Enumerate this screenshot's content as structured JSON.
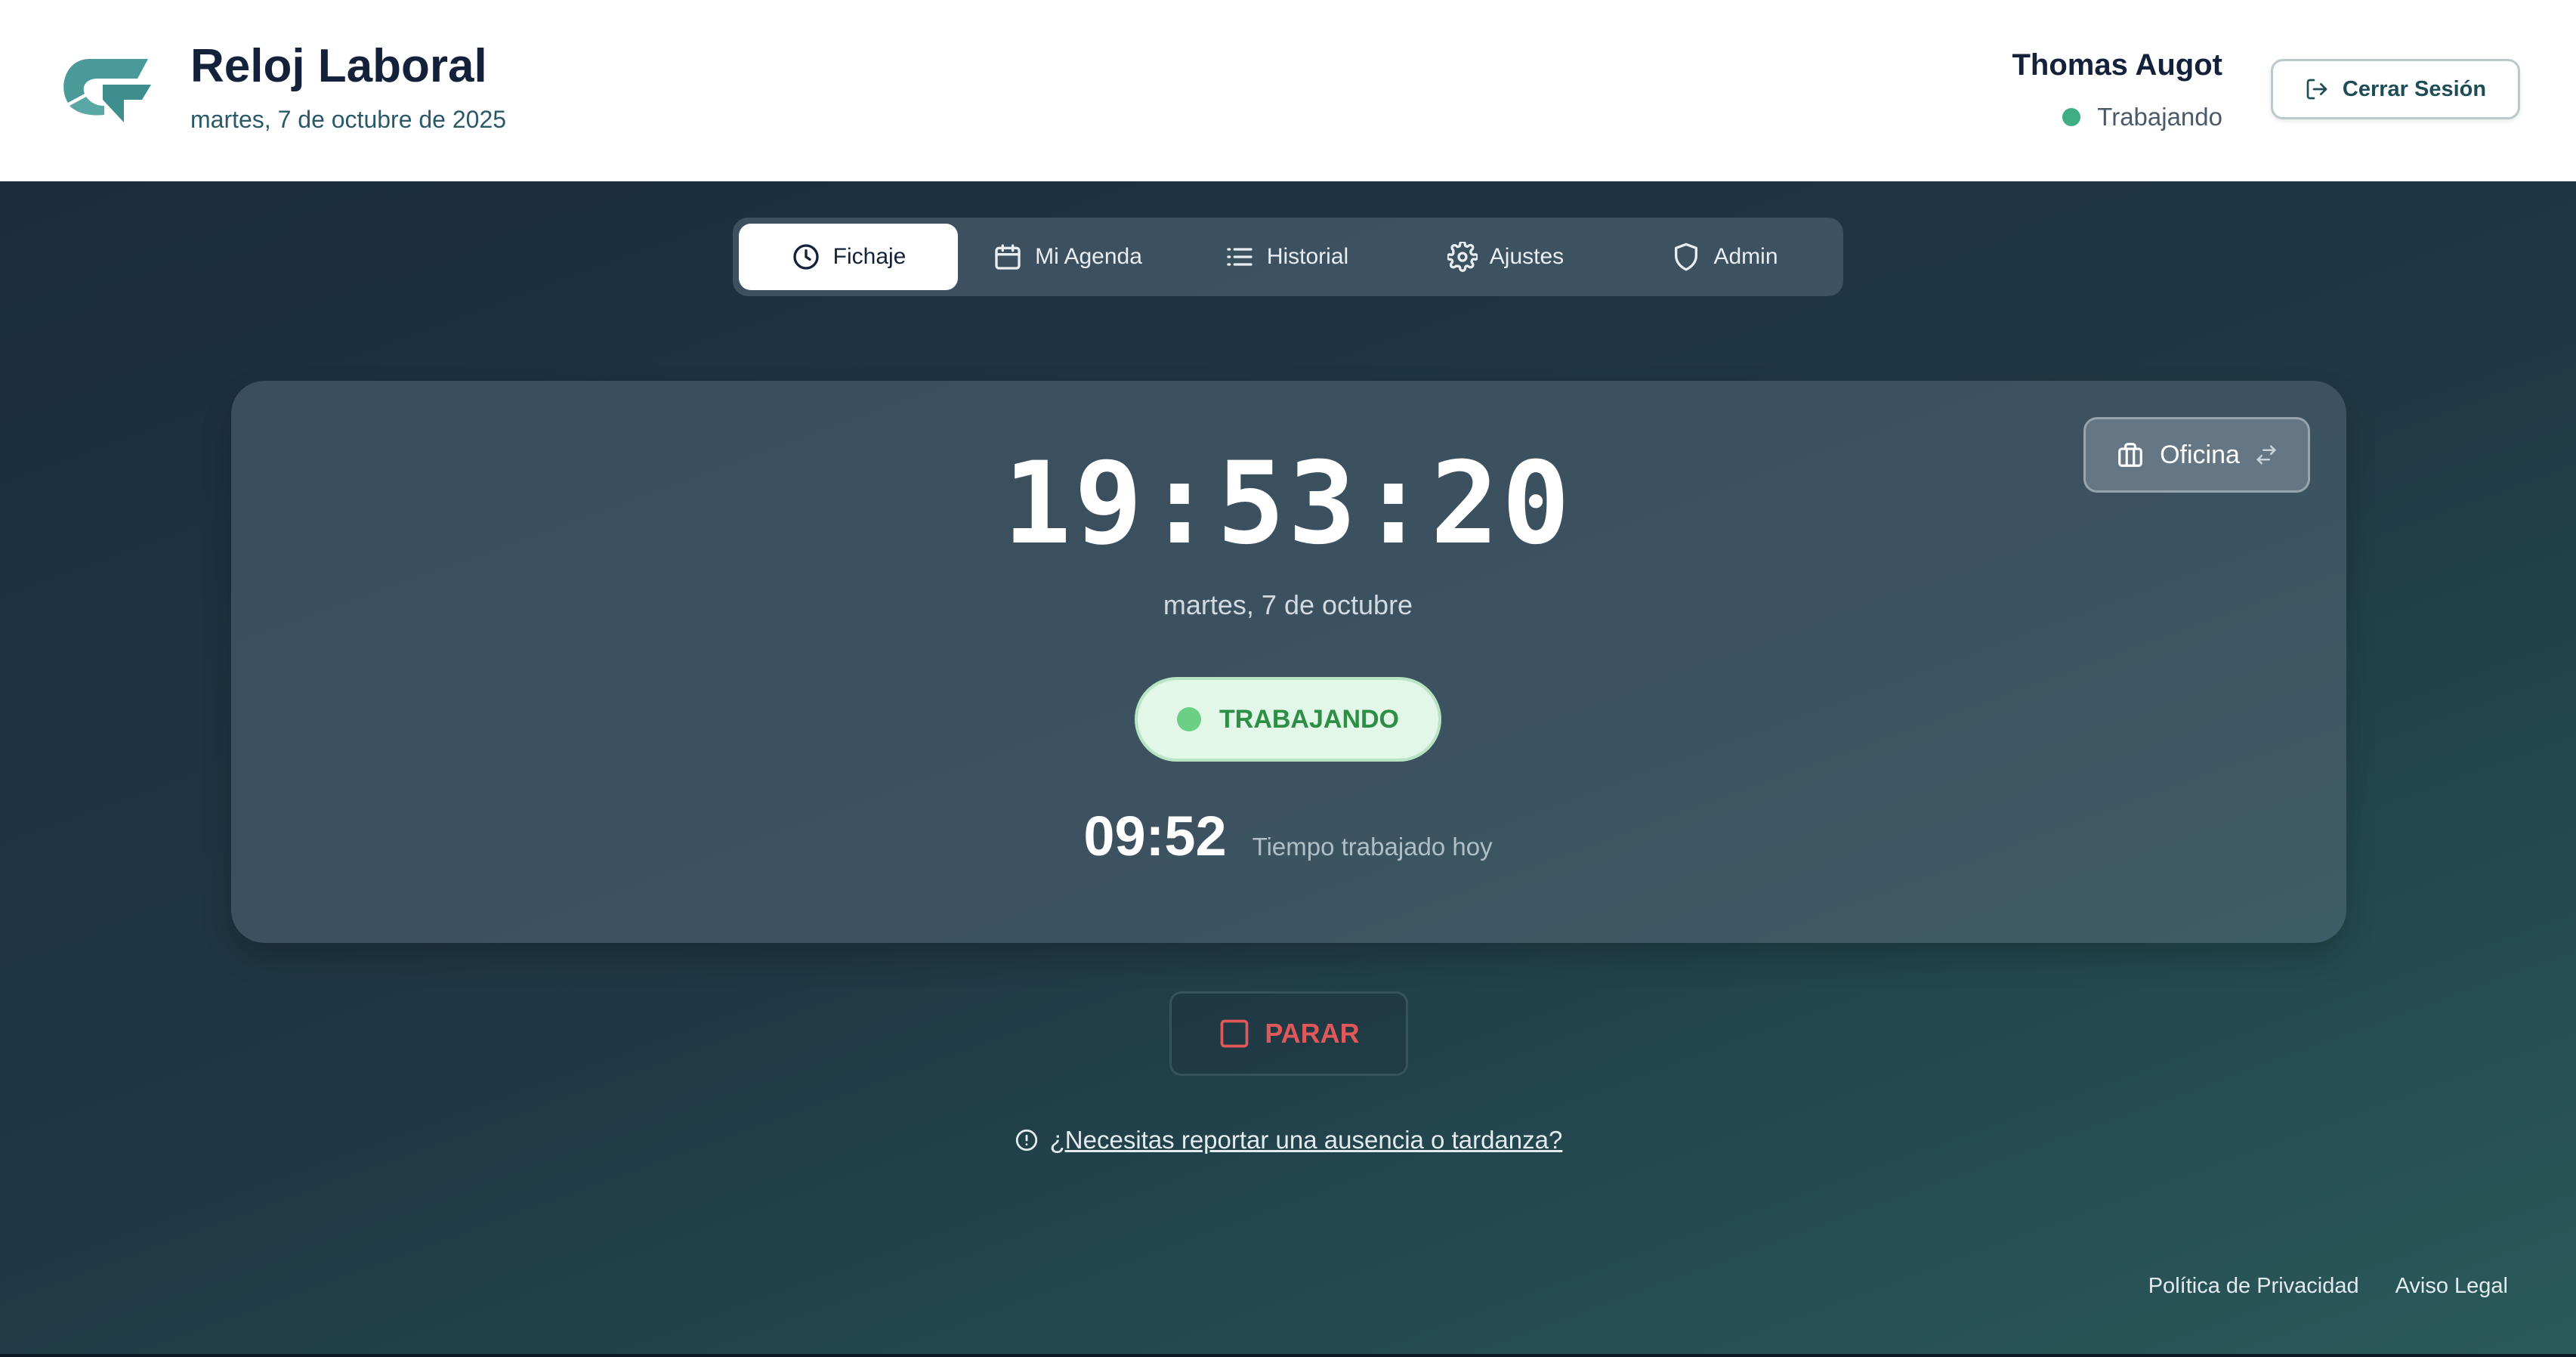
{
  "colors": {
    "brand_teal": "#4a9a9a",
    "status_green": "#3fae84",
    "stop_red": "#e0585a"
  },
  "header": {
    "title": "Reloj Laboral",
    "date": "martes, 7 de octubre de 2025",
    "user_name": "Thomas Augot",
    "user_status": "Trabajando",
    "logout_label": "Cerrar Sesión"
  },
  "tabs": [
    {
      "label": "Fichaje",
      "icon": "clock-icon",
      "active": true
    },
    {
      "label": "Mi Agenda",
      "icon": "calendar-icon",
      "active": false
    },
    {
      "label": "Historial",
      "icon": "list-icon",
      "active": false
    },
    {
      "label": "Ajustes",
      "icon": "gear-icon",
      "active": false
    },
    {
      "label": "Admin",
      "icon": "shield-icon",
      "active": false
    }
  ],
  "card": {
    "location_label": "Oficina",
    "clock": "19:53:20",
    "date": "martes, 7 de octubre",
    "status": "TRABAJANDO",
    "worked_time": "09:52",
    "worked_label": "Tiempo trabajado hoy"
  },
  "actions": {
    "stop_label": "PARAR",
    "report_link": "¿Necesitas reportar una ausencia o tardanza?"
  },
  "footer": {
    "privacy": "Política de Privacidad",
    "legal": "Aviso Legal"
  }
}
